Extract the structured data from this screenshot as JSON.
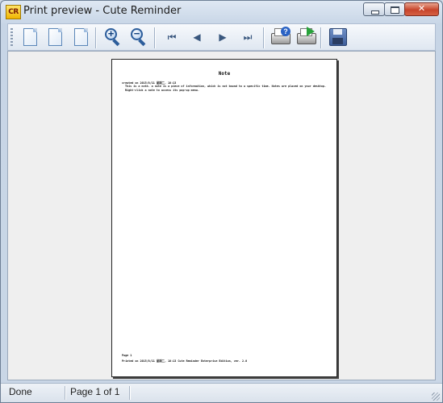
{
  "window": {
    "title": "Print preview - Cute Reminder",
    "app_icon_text": "CR",
    "buttons": {
      "minimize": "minimize-icon",
      "maximize": "maximize-icon",
      "close": "close-icon"
    }
  },
  "toolbar": {
    "items": [
      {
        "name": "page-layout-1-button",
        "icon": "document-icon"
      },
      {
        "name": "page-layout-2-button",
        "icon": "document-icon"
      },
      {
        "name": "page-layout-3-button",
        "icon": "document-icon"
      },
      {
        "name": "zoom-in-button",
        "icon": "zoom-in-icon"
      },
      {
        "name": "zoom-out-button",
        "icon": "zoom-out-icon"
      },
      {
        "name": "first-page-button",
        "icon": "first-page-icon"
      },
      {
        "name": "previous-page-button",
        "icon": "previous-icon"
      },
      {
        "name": "next-page-button",
        "icon": "next-icon"
      },
      {
        "name": "last-page-button",
        "icon": "last-page-icon"
      },
      {
        "name": "print-setup-button",
        "icon": "printer-help-icon"
      },
      {
        "name": "print-button",
        "icon": "printer-arrow-icon"
      },
      {
        "name": "save-button",
        "icon": "floppy-disk-icon"
      }
    ]
  },
  "page": {
    "heading": "Note",
    "created_line": "created on 2015/8/11 星期二, 18:13",
    "body": "This is a note. a note is a piece of information, which is not bound to a specific time. Notes are placed on your desktop. Right-click a note to access its pop-up menu.",
    "footer_page": "Page 1",
    "footer_printed": "Printed on 2015/8/11 星期二, 18:13      Cute Reminder Enterprise Edition, ver. 2.0"
  },
  "status": {
    "state": "Done",
    "page_indicator": "Page 1 of 1"
  }
}
